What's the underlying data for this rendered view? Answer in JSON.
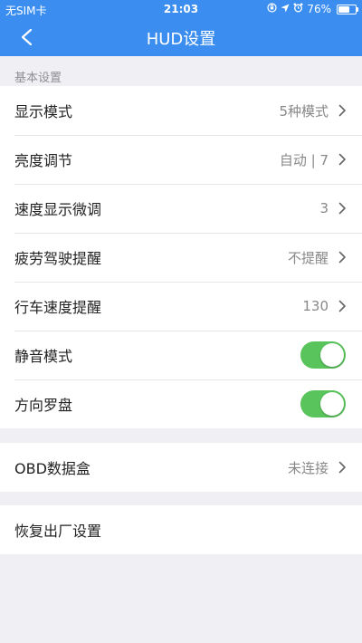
{
  "status_bar": {
    "carrier": "无SIM卡",
    "time": "21:03",
    "battery": "76%",
    "battery_level": 0.76,
    "icons": [
      "orientation-lock-icon",
      "location-arrow-icon",
      "alarm-icon",
      "battery-icon"
    ]
  },
  "nav": {
    "title": "HUD设置",
    "back_icon": "chevron-left-icon"
  },
  "section": {
    "label": "基本设置"
  },
  "settings": [
    {
      "label": "显示模式",
      "value": "5种模式"
    },
    {
      "label": "亮度调节",
      "value": "自动 | 7"
    },
    {
      "label": "速度显示微调",
      "value": "3"
    },
    {
      "label": "疲劳驾驶提醒",
      "value": "不提醒"
    },
    {
      "label": "行车速度提醒",
      "value": "130"
    },
    {
      "label": "静音模式",
      "toggle": true
    },
    {
      "label": "方向罗盘",
      "toggle": true
    }
  ],
  "obd": {
    "label": "OBD数据盒",
    "value": "未连接"
  },
  "reset": {
    "label": "恢复出厂设置"
  },
  "colors": {
    "header": "#3b8ef0",
    "toggle_on": "#59c45c",
    "background": "#efeff4"
  }
}
